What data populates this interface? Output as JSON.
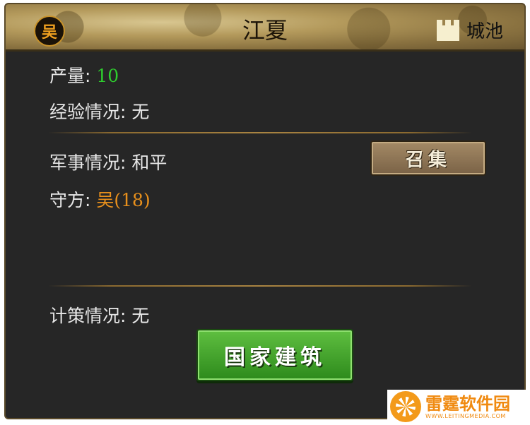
{
  "header": {
    "kingdom_badge": "吴",
    "city_name": "江夏",
    "city_type_icon": "castle-icon",
    "city_type_label": "城池"
  },
  "stats": {
    "output_label": "产量:",
    "output_value": "10",
    "experience_label": "经验情况:",
    "experience_value": "无",
    "military_label": "军事情况:",
    "military_value": "和平",
    "defender_label": "守方:",
    "defender_value": "吴(18)",
    "strategy_label": "计策情况:",
    "strategy_value": "无"
  },
  "buttons": {
    "recruit_label": "召集",
    "national_build_label": "国家建筑"
  },
  "watermark": {
    "cn": "雷霆软件园",
    "en": "WWW.LEITINGMEDIA.COM"
  },
  "colors": {
    "panel_bg": "#262626",
    "green_value": "#2ecc2e",
    "orange_value": "#e8901c",
    "header_gold": "#b49a5c",
    "build_button_green": "#3fa02a"
  }
}
